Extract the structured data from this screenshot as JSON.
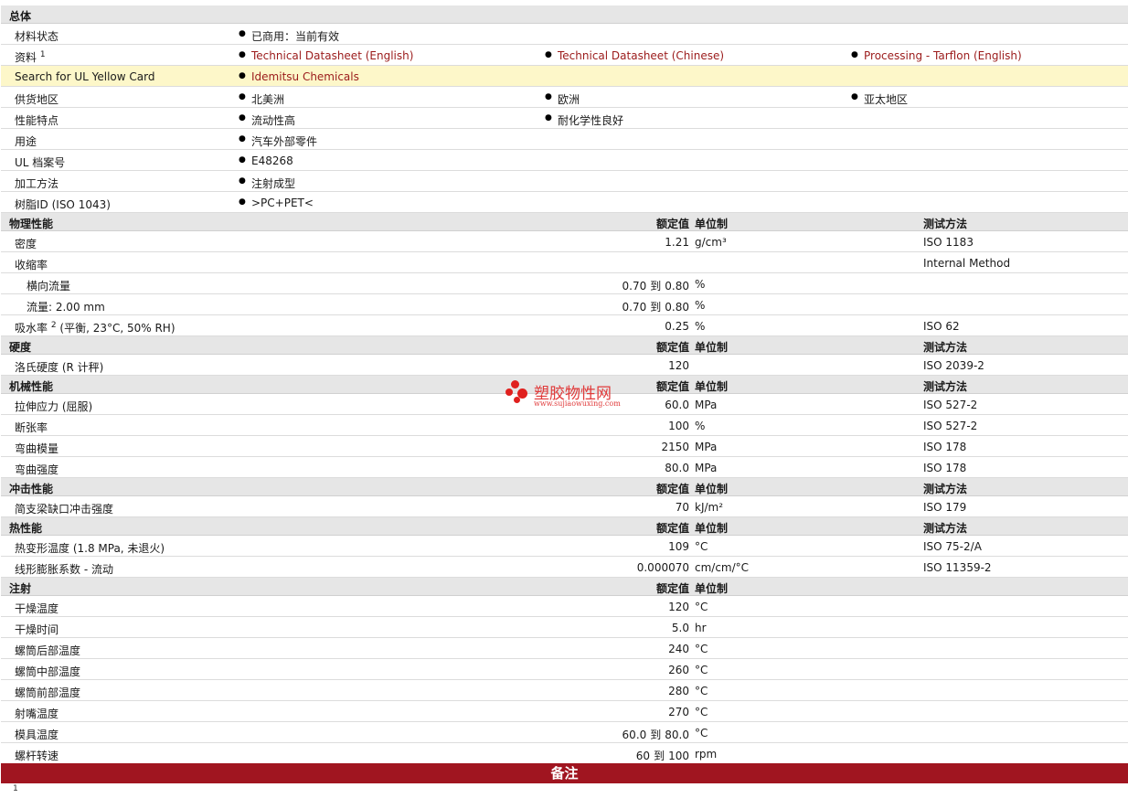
{
  "general": {
    "title": "总体",
    "material_status": {
      "label": "材料状态",
      "value": "已商用：当前有效"
    },
    "documents": {
      "label": "资料",
      "sup": "1",
      "links": [
        "Technical Datasheet (English)",
        "Technical Datasheet (Chinese)",
        "Processing - Tarflon (English)"
      ]
    },
    "ul_card": {
      "label": "Search for UL Yellow Card",
      "link": "Idemitsu Chemicals"
    },
    "regions": {
      "label": "供货地区",
      "values": [
        "北美洲",
        "欧洲",
        "亚太地区"
      ]
    },
    "features": {
      "label": "性能特点",
      "values": [
        "流动性高",
        "耐化学性良好"
      ]
    },
    "uses": {
      "label": "用途",
      "value": "汽车外部零件"
    },
    "ul_file": {
      "label": "UL 档案号",
      "value": "E48268"
    },
    "processing": {
      "label": "加工方法",
      "value": "注射成型"
    },
    "resin_id": {
      "label": "树脂ID (ISO 1043)",
      "value": ">PC+PET<"
    }
  },
  "headers": {
    "rated": "额定值",
    "unit": "单位制",
    "test": "测试方法"
  },
  "sections": {
    "physical": {
      "title": "物理性能",
      "density": {
        "label": "密度",
        "value": "1.21",
        "unit": "g/cm³",
        "test": "ISO 1183"
      },
      "shrinkage": {
        "label": "收缩率",
        "test": "Internal Method"
      },
      "shrink_transverse": {
        "label": "横向流量",
        "min": "0.70",
        "to": "到",
        "max": "0.80",
        "unit": "%"
      },
      "shrink_flow": {
        "label": "流量: 2.00 mm",
        "min": "0.70",
        "to": "到",
        "max": "0.80",
        "unit": "%"
      },
      "water_abs": {
        "label": "吸水率",
        "sup": "2",
        "label_suffix": " (平衡, 23°C, 50% RH)",
        "value": "0.25",
        "unit": "%",
        "test": "ISO 62"
      }
    },
    "hardness": {
      "title": "硬度",
      "rockwell": {
        "label": "洛氏硬度 (R 计秤)",
        "value": "120",
        "test": "ISO 2039-2"
      }
    },
    "mechanical": {
      "title": "机械性能",
      "tensile": {
        "label": "拉伸应力 (屈服)",
        "value": "60.0",
        "unit": "MPa",
        "test": "ISO 527-2"
      },
      "elongation": {
        "label": "断张率",
        "value": "100",
        "unit": "%",
        "test": "ISO 527-2"
      },
      "flex_modulus": {
        "label": "弯曲模量",
        "value": "2150",
        "unit": "MPa",
        "test": "ISO 178"
      },
      "flex_strength": {
        "label": "弯曲强度",
        "value": "80.0",
        "unit": "MPa",
        "test": "ISO 178"
      }
    },
    "impact": {
      "title": "冲击性能",
      "charpy": {
        "label": "简支梁缺口冲击强度",
        "value": "70",
        "unit": "kJ/m²",
        "test": "ISO 179"
      }
    },
    "thermal": {
      "title": "热性能",
      "hdt": {
        "label": "热变形温度 (1.8 MPa, 未退火)",
        "value": "109",
        "unit": "°C",
        "test": "ISO 75-2/A"
      },
      "clte": {
        "label": "线形膨胀系数 - 流动",
        "value": "0.000070",
        "unit": "cm/cm/°C",
        "test": "ISO 11359-2"
      }
    },
    "injection": {
      "title": "注射",
      "rows": [
        {
          "label": "干燥温度",
          "value": "120",
          "unit": "°C"
        },
        {
          "label": "干燥时间",
          "value": "5.0",
          "unit": "hr"
        },
        {
          "label": "螺筒后部温度",
          "value": "240",
          "unit": "°C"
        },
        {
          "label": "螺筒中部温度",
          "value": "260",
          "unit": "°C"
        },
        {
          "label": "螺筒前部温度",
          "value": "280",
          "unit": "°C"
        },
        {
          "label": "射嘴温度",
          "value": "270",
          "unit": "°C"
        }
      ],
      "mold_temp": {
        "label": "模具温度",
        "min": "60.0",
        "to": "到",
        "max": "80.0",
        "unit": "°C"
      },
      "screw_speed": {
        "label": "螺杆转速",
        "min": "60",
        "to": "到",
        "max": "100",
        "unit": "rpm"
      }
    }
  },
  "notes": {
    "title": "备注",
    "footnote_num": "1"
  },
  "watermark": {
    "text": "塑胶物性网",
    "url": "www.sujiaowuxing.com",
    "color": "#e0201e"
  },
  "colors": {
    "link": "#9b1b1b",
    "section_bg": "#e6e6e6",
    "highlight": "#fdf7c9",
    "notes_bar": "#a01520"
  }
}
